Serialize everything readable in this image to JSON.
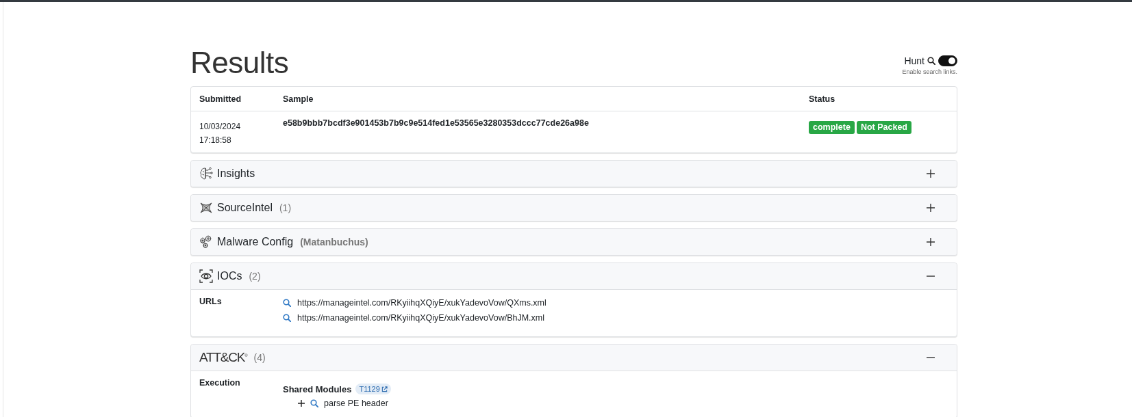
{
  "header": {
    "title": "Results",
    "hunt": {
      "label": "Hunt",
      "on": true,
      "hint": "Enable search links."
    }
  },
  "submission": {
    "columns": [
      "Submitted",
      "Sample",
      "Status"
    ],
    "rows": [
      {
        "submitted": "10/03/2024 17:18:58",
        "sample": "e58b9bbb7bcdf3e901453b7b9c9e514fed1e53565e3280353dccc77cde26a98e",
        "badges": [
          "complete",
          "Not Packed"
        ]
      }
    ]
  },
  "sections": [
    {
      "kind": "insights",
      "title": "Insights",
      "expanded": false
    },
    {
      "kind": "sourceintel",
      "title": "SourceIntel",
      "count": "(1)",
      "expanded": false
    },
    {
      "kind": "config",
      "title": "Malware Config",
      "count": "(Matanbuchus)",
      "expanded": false
    },
    {
      "kind": "iocs",
      "title": "IOCs",
      "count": "(2)",
      "expanded": true,
      "groups": [
        {
          "label": "URLs",
          "items": [
            "https://manageintel.com/RKyiihqXQiyE/xukYadevoVow/QXms.xml",
            "https://manageintel.com/RKyiihqXQiyE/xukYadevoVow/BhJM.xml"
          ]
        }
      ]
    },
    {
      "kind": "attack",
      "title": "ATT&CK$^{®}$",
      "count": "(4)",
      "expanded": true,
      "tactics": [
        {
          "label": "Execution",
          "techniques": [
            {
              "name": "Shared Modules",
              "id": "T1129",
              "children": [
                {
                  "label": "parse PE header",
                  "expanded": false
                }
              ]
            }
          ]
        }
      ]
    }
  ]
}
